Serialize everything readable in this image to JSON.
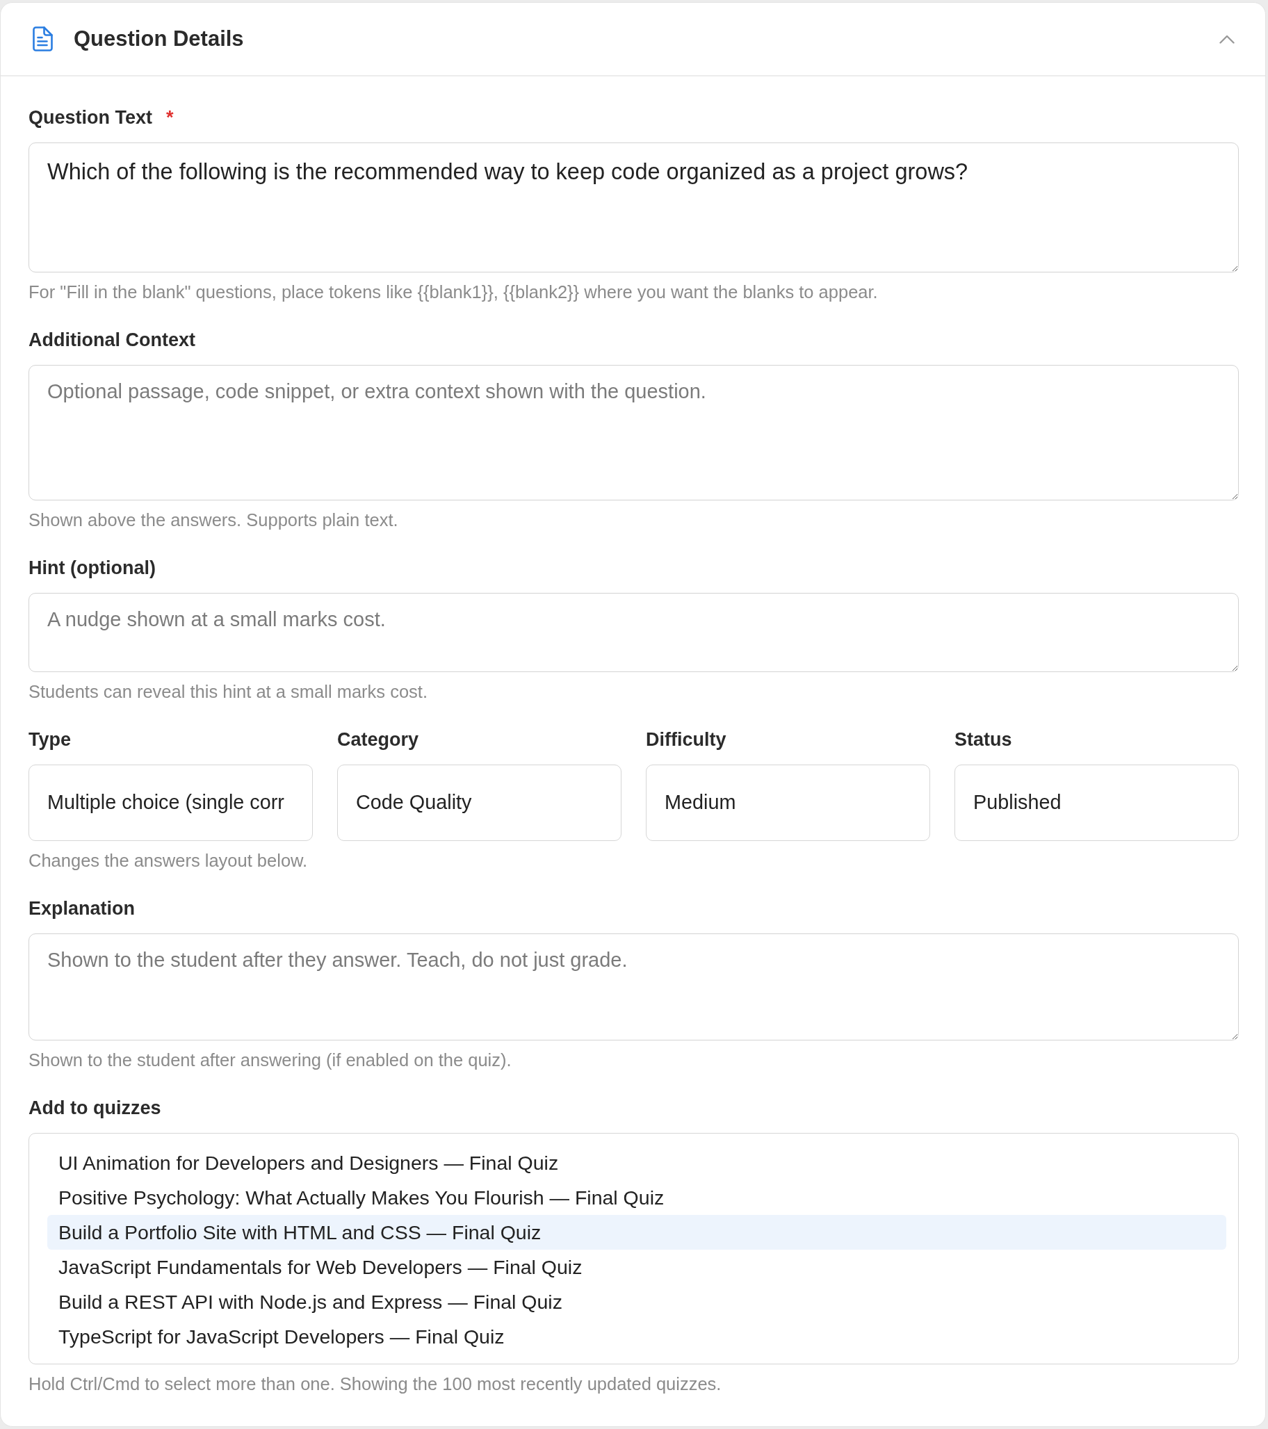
{
  "header": {
    "title": "Question Details",
    "expanded": true
  },
  "question_text": {
    "label": "Question Text",
    "required_mark": "*",
    "value": "Which of the following is the recommended way to keep code organized as a project grows?",
    "help": "For \"Fill in the blank\" questions, place tokens like {{blank1}}, {{blank2}} where you want the blanks to appear."
  },
  "additional_context": {
    "label": "Additional Context",
    "placeholder": "Optional passage, code snippet, or extra context shown with the question.",
    "help": "Shown above the answers. Supports plain text."
  },
  "hint": {
    "label": "Hint (optional)",
    "placeholder": "A nudge shown at a small marks cost.",
    "help": "Students can reveal this hint at a small marks cost."
  },
  "selects": [
    {
      "label": "Type",
      "value": "Multiple choice (single corr",
      "help": "Changes the answers layout below."
    },
    {
      "label": "Category",
      "value": "Code Quality"
    },
    {
      "label": "Difficulty",
      "value": "Medium"
    },
    {
      "label": "Status",
      "value": "Published"
    }
  ],
  "explanation": {
    "label": "Explanation",
    "placeholder": "Shown to the student after they answer. Teach, do not just grade.",
    "help": "Shown to the student after answering (if enabled on the quiz)."
  },
  "add_to_quizzes": {
    "label": "Add to quizzes",
    "options": [
      {
        "label": "UI Animation for Developers and Designers — Final Quiz",
        "selected": false
      },
      {
        "label": "Positive Psychology: What Actually Makes You Flourish — Final Quiz",
        "selected": false
      },
      {
        "label": "Build a Portfolio Site with HTML and CSS — Final Quiz",
        "selected": true
      },
      {
        "label": "JavaScript Fundamentals for Web Developers — Final Quiz",
        "selected": false
      },
      {
        "label": "Build a REST API with Node.js and Express — Final Quiz",
        "selected": false
      },
      {
        "label": "TypeScript for JavaScript Developers — Final Quiz",
        "selected": false
      }
    ],
    "help": "Hold Ctrl/Cmd to select more than one. Showing the 100 most recently updated quizzes."
  }
}
